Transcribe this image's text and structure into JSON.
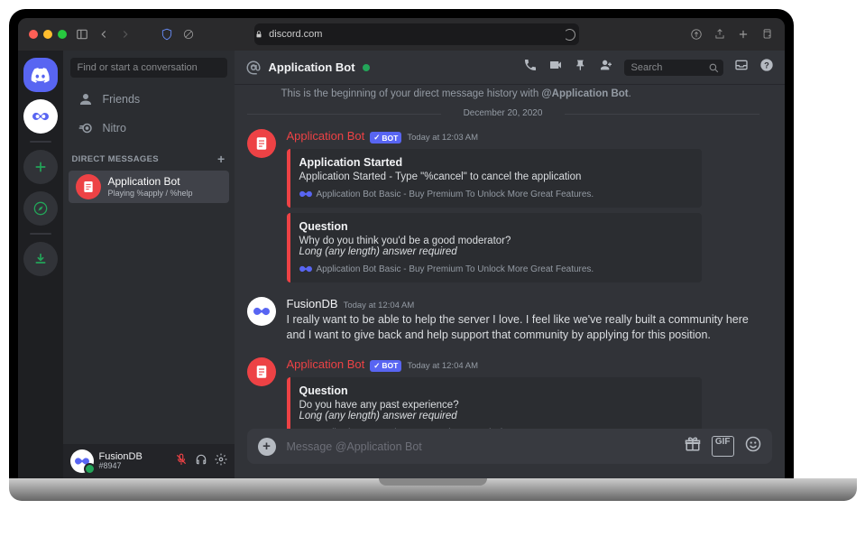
{
  "browser": {
    "url": "discord.com"
  },
  "sidebar": {
    "search_placeholder": "Find or start a conversation",
    "friends_label": "Friends",
    "nitro_label": "Nitro",
    "dm_header": "DIRECT MESSAGES",
    "dm": {
      "name": "Application Bot",
      "status": "Playing %apply / %help"
    }
  },
  "user_panel": {
    "name": "FusionDB",
    "discriminator": "#8947"
  },
  "header": {
    "title": "Application Bot",
    "search_placeholder": "Search"
  },
  "chat": {
    "beginning_prefix": "This is the beginning of your direct message history with ",
    "beginning_mention": "@Application Bot",
    "date_divider": "December 20, 2020",
    "bot_tag": "BOT",
    "footer_text": "Application Bot Basic - Buy Premium To Unlock More Great Features.",
    "msg1": {
      "author": "Application Bot",
      "time": "Today at 12:03 AM",
      "embed1": {
        "title": "Application Started",
        "desc": "Application Started - Type \"%cancel\" to cancel the application"
      },
      "embed2": {
        "title": "Question",
        "desc_q": "Why do you think you'd be a good moderator?",
        "desc_hint": "Long (any length) answer required"
      }
    },
    "msg2": {
      "author": "FusionDB",
      "time": "Today at 12:04 AM",
      "text": "I really want to be able to help the server I love. I feel like we've really built a community here and I want to give back and help support that community by applying for this position."
    },
    "msg3": {
      "author": "Application Bot",
      "time": "Today at 12:04 AM",
      "embed": {
        "title": "Question",
        "desc_q": "Do you have any past experience?",
        "desc_hint": "Long (any length) answer required"
      }
    }
  },
  "input": {
    "placeholder": "Message @Application Bot"
  }
}
